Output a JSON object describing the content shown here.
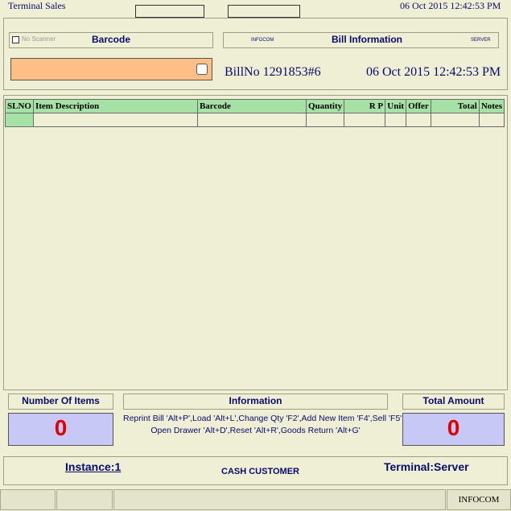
{
  "header": {
    "title": "Terminal Sales",
    "datetime": "06 Oct 2015 12:42:53 PM"
  },
  "barcode": {
    "title": "Barcode",
    "no_scanner_label": "No Scanner",
    "input_value": ""
  },
  "bill": {
    "left_tag": "INFOCOM",
    "title": "Bill Information",
    "right_tag": "SERVER",
    "bill_no": "BillNo 1291853#6",
    "datetime": "06 Oct 2015 12:42:53 PM"
  },
  "table": {
    "columns": [
      "SLNO",
      "Item Description",
      "Barcode",
      "Quantity",
      "R P",
      "Unit",
      "Offer",
      "Total",
      "Notes"
    ],
    "rows": [
      [
        "",
        "",
        "",
        "",
        "",
        "",
        "",
        "",
        ""
      ]
    ]
  },
  "summary": {
    "items_title": "Number Of Items",
    "items_value": "0",
    "info_title": "Information",
    "info_line1": "Reprint Bill 'Alt+P',Load 'Alt+L',Change Qty 'F2',Add New Item 'F4',Sell 'F5'",
    "info_line2": "Open Drawer 'Alt+D',Reset 'Alt+R',Goods Return 'Alt+G'",
    "total_title": "Total Amount",
    "total_value": "0"
  },
  "footer": {
    "instance": "Instance:1",
    "customer": "CASH CUSTOMER",
    "terminal": "Terminal:Server"
  },
  "statusbar": {
    "company": "INFOCOM"
  },
  "colors": {
    "background": "#efefd6",
    "header_green": "#a6e2a6",
    "input_orange": "#fdbf85",
    "count_box": "#c8c8f6",
    "zero_red": "#e00000",
    "text_navy": "#0a0a6e"
  }
}
